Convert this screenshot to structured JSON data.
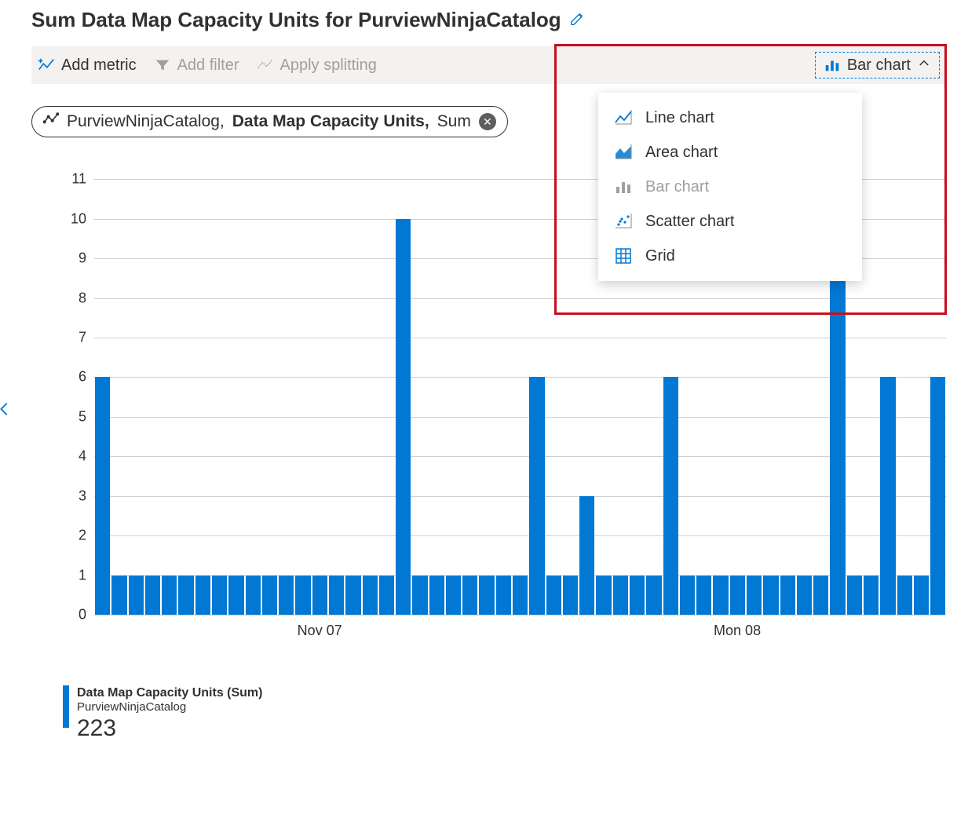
{
  "title": "Sum Data Map Capacity Units for PurviewNinjaCatalog",
  "toolbar": {
    "add_metric": "Add metric",
    "add_filter": "Add filter",
    "apply_splitting": "Apply splitting",
    "chart_type": "Bar chart"
  },
  "metric_pill": {
    "resource": "PurviewNinjaCatalog, ",
    "metric": "Data Map Capacity Units,",
    "aggregation": " Sum"
  },
  "chart_menu": {
    "line": "Line chart",
    "area": "Area chart",
    "bar": "Bar chart",
    "scatter": "Scatter chart",
    "grid": "Grid"
  },
  "legend": {
    "metric": "Data Map Capacity Units (Sum)",
    "resource": "PurviewNinjaCatalog",
    "value": "223"
  },
  "colors": {
    "accent": "#0078d4",
    "highlight": "#c50f1f"
  },
  "chart_data": {
    "type": "bar",
    "title": "Sum Data Map Capacity Units for PurviewNinjaCatalog",
    "ylabel": "",
    "xlabel": "",
    "ylim": [
      0,
      11.5
    ],
    "yticks": [
      0,
      1,
      2,
      3,
      4,
      5,
      6,
      7,
      8,
      9,
      10,
      11
    ],
    "xticks": [
      {
        "index": 13,
        "label": "Nov 07"
      },
      {
        "index": 38,
        "label": "Mon 08"
      }
    ],
    "values": [
      6,
      1,
      1,
      1,
      1,
      1,
      1,
      1,
      1,
      1,
      1,
      1,
      1,
      1,
      1,
      1,
      1,
      1,
      10,
      1,
      1,
      1,
      1,
      1,
      1,
      1,
      6,
      1,
      1,
      3,
      1,
      1,
      1,
      1,
      6,
      1,
      1,
      1,
      1,
      1,
      1,
      1,
      1,
      1,
      9,
      1,
      1,
      6,
      1,
      1,
      6
    ],
    "sum": 223
  }
}
